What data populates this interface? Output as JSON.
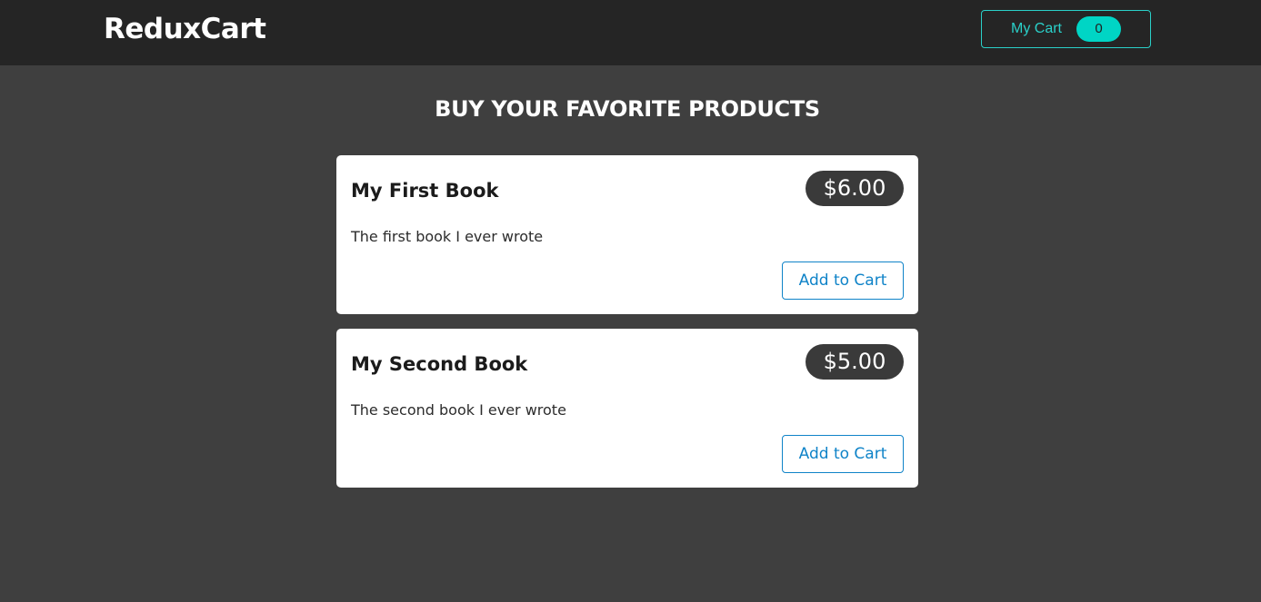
{
  "header": {
    "logo": "ReduxCart",
    "cart": {
      "label": "My Cart",
      "count": "0"
    }
  },
  "main": {
    "title": "BUY YOUR FAVORITE PRODUCTS",
    "products": [
      {
        "title": "My First Book",
        "price": "$6.00",
        "description": "The first book I ever wrote",
        "button_label": "Add to Cart"
      },
      {
        "title": "My Second Book",
        "price": "$5.00",
        "description": "The second book I ever wrote",
        "button_label": "Add to Cart"
      }
    ]
  },
  "colors": {
    "background": "#3f3f3f",
    "header_background": "#252525",
    "accent_teal": "#00d5c5",
    "button_blue": "#0f83c8",
    "price_badge": "#3a3a3a"
  }
}
